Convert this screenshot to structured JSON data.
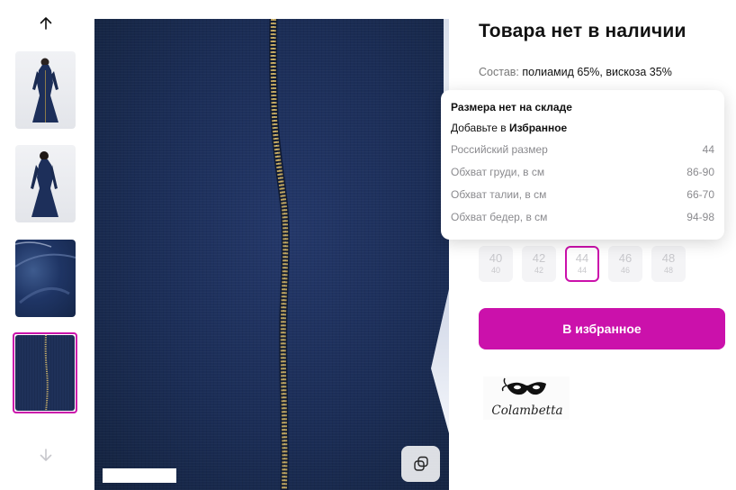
{
  "product": {
    "title": "Товара нет в наличии",
    "composition_label": "Состав:",
    "composition_value": "полиамид 65%, вискоза 35%"
  },
  "gallery": {
    "up_icon": "arrow-up-icon",
    "down_icon": "arrow-down-icon",
    "copy_icon": "copy-icon",
    "thumbnail_count": 4,
    "active_index": 4
  },
  "popup": {
    "heading": "Размера нет на складе",
    "hint_prefix": "Добавьте в",
    "hint_bold": "Избранное",
    "rows": [
      {
        "label": "Российский размер",
        "value": "44"
      },
      {
        "label": "Обхват груди, в см",
        "value": "86-90"
      },
      {
        "label": "Обхват талии, в см",
        "value": "66-70"
      },
      {
        "label": "Обхват бедер, в см",
        "value": "94-98"
      }
    ]
  },
  "sizes": [
    {
      "size": "40",
      "ru": "40",
      "selected": false
    },
    {
      "size": "42",
      "ru": "42",
      "selected": false
    },
    {
      "size": "44",
      "ru": "44",
      "selected": true
    },
    {
      "size": "46",
      "ru": "46",
      "selected": false
    },
    {
      "size": "48",
      "ru": "48",
      "selected": false
    }
  ],
  "actions": {
    "favorite_label": "В избранное"
  },
  "brand": {
    "name": "Colambetta"
  },
  "colors": {
    "accent": "#cb11ab",
    "fabric": "#1c2e57"
  }
}
